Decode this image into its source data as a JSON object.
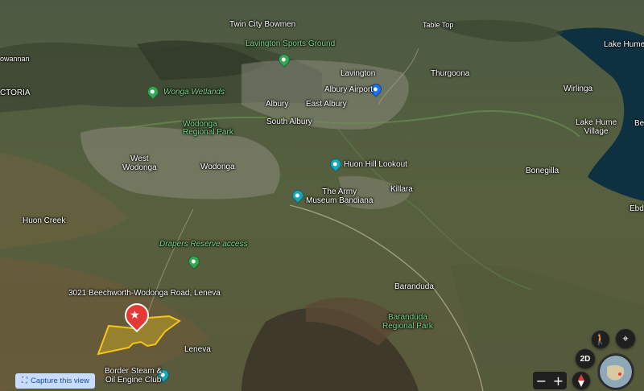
{
  "places": {
    "twin_city_bowmen": "Twin City Bowmen",
    "table_top": "Table Top",
    "lavington_sports_ground": "Lavington Sports Ground",
    "lake_hume": "Lake Hume",
    "owannan": "owannan",
    "lavington": "Lavington",
    "thurgoona": "Thurgoona",
    "victoria": "CTORIA",
    "wonga_wetlands": "Wonga Wetlands",
    "albury_airport": "Albury Airport",
    "wirlinga": "Wirlinga",
    "albury": "Albury",
    "east_albury": "East Albury",
    "wodonga_regional_park": "Wodonga\nRegional Park",
    "south_albury": "South Albury",
    "lake_hume_village": "Lake Hume\nVillage",
    "west_wodonga": "West\nWodonga",
    "wodonga": "Wodonga",
    "huon_hill_lookout": "Huon Hill Lookout",
    "bonegilla": "Bonegilla",
    "the_army_museum": "The Army\nMuseum Bandiana",
    "killara": "Killara",
    "ebden": "Ebde",
    "huon_creek": "Huon Creek",
    "drapers_reserve": "Drapers Reserve access",
    "address": "3021 Beechworth-Wodonga Road, Leneva",
    "baranduda": "Baranduda",
    "baranduda_regional_park": "Baranduda\nRegional Park",
    "leneva": "Leneva",
    "border_steam": "Border Steam &\nOil Engine Club",
    "belv": "Belv"
  },
  "controls": {
    "capture_label": "Capture this view",
    "mode_2d": "2D",
    "zoom_out": "−",
    "zoom_in": "+"
  },
  "colors": {
    "selected_pin": "#e53935",
    "parcel_outline": "#f5c518",
    "lake": "#0e3142",
    "poi_green": "#34a853",
    "poi_teal": "#1aa6b7",
    "airport_blue": "#1a73e8"
  }
}
